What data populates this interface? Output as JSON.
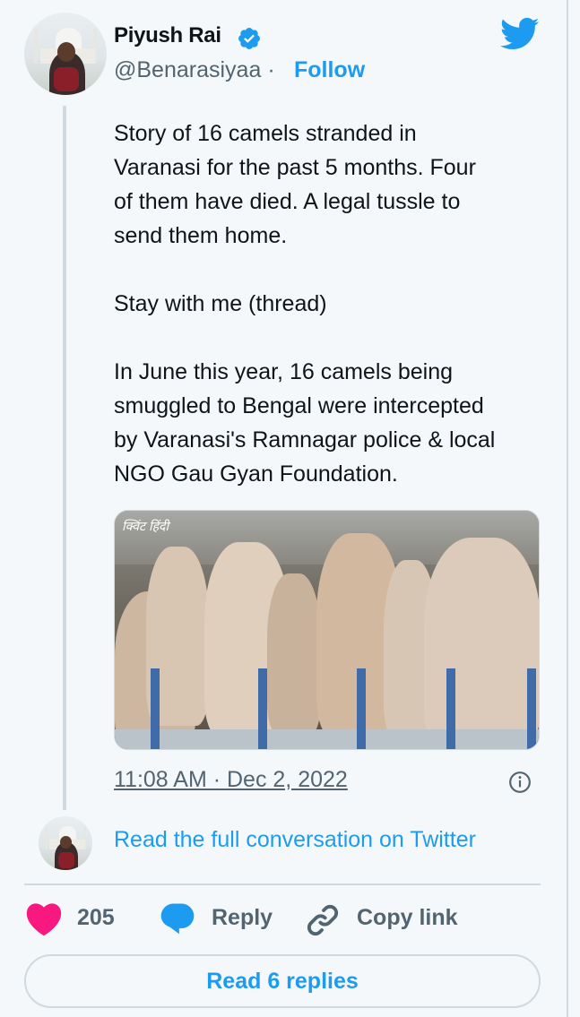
{
  "author": {
    "name": "Piyush Rai",
    "handle": "@Benarasiyaa",
    "separator": "·",
    "follow_label": "Follow"
  },
  "tweet": {
    "paragraphs": [
      "Story of 16 camels stranded in\nVaranasi for the past 5 months. Four\nof them have died. A legal tussle to\nsend them home.",
      "Stay with me (thread)",
      "In June this year, 16 camels being\nsmuggled to Bengal were intercepted\nby Varanasi's Ramnagar police & local\nNGO Gau Gyan Foundation."
    ],
    "media_watermark": "क्विंट हिंदी",
    "timestamp": "11:08 AM · Dec 2, 2022"
  },
  "conversation": {
    "read_full_label": "Read the full conversation on Twitter"
  },
  "actions": {
    "like_count": "205",
    "reply_label": "Reply",
    "copy_link_label": "Copy link",
    "read_replies_label": "Read 6 replies"
  },
  "colors": {
    "accent": "#1d9bf0",
    "like": "#f91880",
    "muted": "#536471",
    "border": "#cfd9de",
    "background": "#f5f8fa"
  },
  "icons": [
    "verified-badge-icon",
    "twitter-bird-icon",
    "info-icon",
    "heart-icon",
    "reply-bubble-icon",
    "link-icon"
  ]
}
